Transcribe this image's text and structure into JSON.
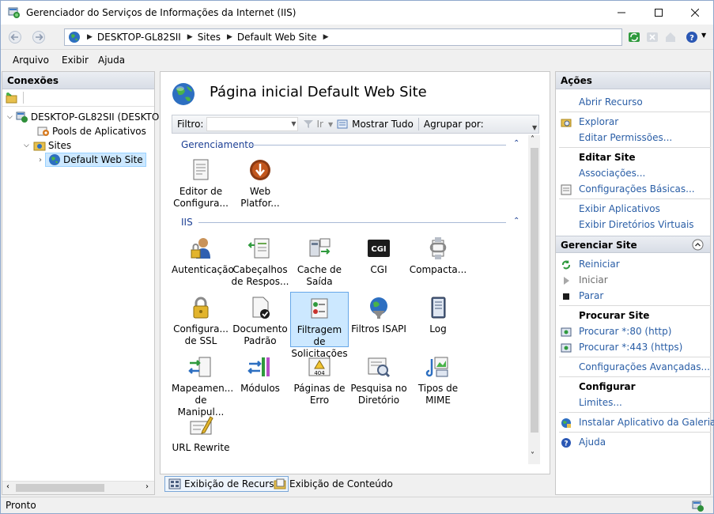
{
  "window": {
    "title": "Gerenciador do Serviços de Informações da Internet (IIS)"
  },
  "address": {
    "crumbs": [
      "DESKTOP-GL82SII",
      "Sites",
      "Default Web Site"
    ]
  },
  "menu": {
    "file": "Arquivo",
    "view": "Exibir",
    "help": "Ajuda"
  },
  "connections": {
    "title": "Conexões",
    "tree": {
      "server": "DESKTOP-GL82SII (DESKTOP",
      "pools": "Pools de Aplicativos",
      "sites": "Sites",
      "site": "Default Web Site"
    }
  },
  "center": {
    "title": "Página inicial Default Web Site",
    "filter": {
      "label": "Filtro:",
      "go": "Ir",
      "show_all": "Mostrar Tudo",
      "group_by": "Agrupar por:"
    },
    "groups": {
      "management": {
        "name": "Gerenciamento",
        "items": [
          {
            "l1": "Editor de",
            "l2": "Configura..."
          },
          {
            "l1": "Web",
            "l2": "Platfor..."
          }
        ]
      },
      "iis": {
        "name": "IIS",
        "items": [
          {
            "l1": "Autenticação",
            "l2": ""
          },
          {
            "l1": "Cabeçalhos",
            "l2": "de Respos..."
          },
          {
            "l1": "Cache de",
            "l2": "Saída"
          },
          {
            "l1": "CGI",
            "l2": ""
          },
          {
            "l1": "Compacta...",
            "l2": ""
          },
          {
            "l1": "Configura...",
            "l2": "de SSL"
          },
          {
            "l1": "Documento",
            "l2": "Padrão"
          },
          {
            "l1": "Filtragem de",
            "l2": "Solicitações"
          },
          {
            "l1": "Filtros ISAPI",
            "l2": ""
          },
          {
            "l1": "Log",
            "l2": ""
          },
          {
            "l1": "Mapeamen...",
            "l2": "de Manipul..."
          },
          {
            "l1": "Módulos",
            "l2": ""
          },
          {
            "l1": "Páginas de",
            "l2": "Erro"
          },
          {
            "l1": "Pesquisa no",
            "l2": "Diretório"
          },
          {
            "l1": "Tipos de",
            "l2": "MIME"
          },
          {
            "l1": "URL Rewrite",
            "l2": ""
          }
        ]
      }
    },
    "cgi_badge": "CGI",
    "error_badge": "404",
    "views": {
      "features": "Exibição de Recursos",
      "content": "Exibição de Conteúdo"
    }
  },
  "actions": {
    "title": "Ações",
    "open_feature": "Abrir Recurso",
    "explore": "Explorar",
    "edit_permissions": "Editar Permissões...",
    "edit_site": "Editar Site",
    "bindings": "Associações...",
    "basic_settings": "Configurações Básicas...",
    "view_apps": "Exibir Aplicativos",
    "view_vdirs": "Exibir Diretórios Virtuais",
    "manage_site": "Gerenciar Site",
    "restart": "Reiniciar",
    "start": "Iniciar",
    "stop": "Parar",
    "browse_site": "Procurar Site",
    "browse_80": "Procurar *:80 (http)",
    "browse_443": "Procurar *:443 (https)",
    "advanced": "Configurações Avançadas...",
    "configure": "Configurar",
    "limits": "Limites...",
    "install_gallery": "Instalar Aplicativo da Galeria",
    "help": "Ajuda"
  },
  "status": {
    "text": "Pronto"
  }
}
